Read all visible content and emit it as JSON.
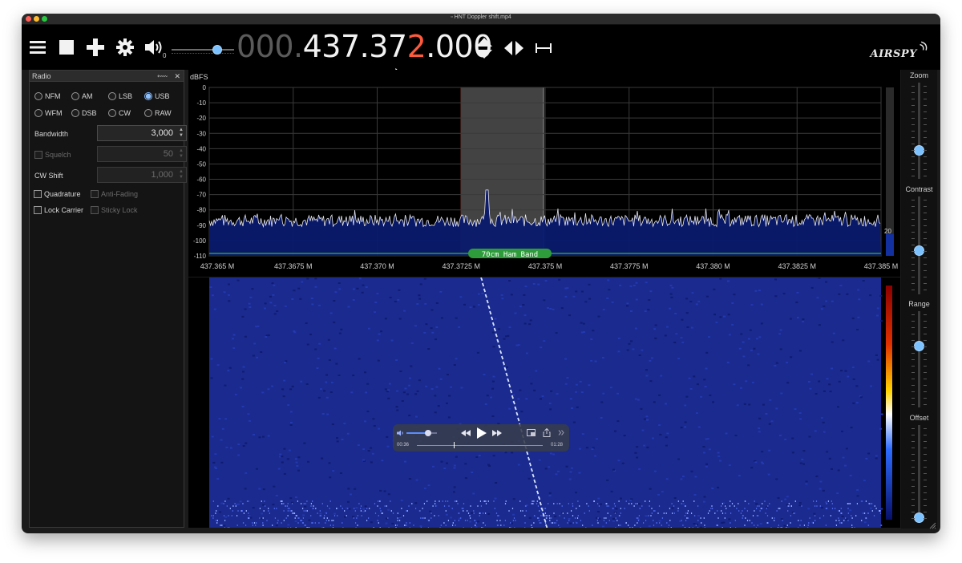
{
  "window": {
    "title": "HNT Doppler shift.mp4"
  },
  "toolbar": {
    "volume_sub": "0",
    "frequency": {
      "dim": "000.",
      "lit1": "437.37",
      "hot": "2",
      "lit2": ".000"
    },
    "brand": "AIRSPY"
  },
  "radio_panel": {
    "title": "Radio",
    "header_pin": "⬳",
    "header_close": "✕",
    "modes_row1": [
      "NFM",
      "AM",
      "LSB",
      "USB"
    ],
    "modes_row2": [
      "WFM",
      "DSB",
      "CW",
      "RAW"
    ],
    "selected_mode": "USB",
    "bandwidth_label": "Bandwidth",
    "bandwidth_value": "3,000",
    "squelch_label": "Squelch",
    "squelch_value": "50",
    "cw_shift_label": "CW Shift",
    "cw_shift_value": "1,000",
    "quadrature_label": "Quadrature",
    "anti_fading_label": "Anti-Fading",
    "lock_carrier_label": "Lock Carrier",
    "sticky_lock_label": "Sticky Lock"
  },
  "spectrum": {
    "unit_label": "dBFS",
    "y_ticks": [
      "0",
      "-10",
      "-20",
      "-30",
      "-40",
      "-50",
      "-60",
      "-70",
      "-80",
      "-90",
      "-100",
      "-110"
    ],
    "x_ticks": [
      "437.365 M",
      "437.3675 M",
      "437.370 M",
      "437.3725 M",
      "437.375 M",
      "437.3775 M",
      "437.380 M",
      "437.3825 M",
      "437.385 M"
    ],
    "band_label": "70cm Ham Band",
    "level_readout": "20",
    "colors": {
      "grid": "#3a3a3a",
      "trace": "#e8e8f0",
      "fill": "#0a1a6e",
      "band": "#2e9c3a",
      "filter": "#5a5a5a",
      "edge": "#c0392b"
    }
  },
  "right_sliders": {
    "zoom": "Zoom",
    "contrast": "Contrast",
    "range": "Range",
    "offset": "Offset"
  },
  "player": {
    "elapsed": "00:36",
    "remaining": "01:28",
    "progress": 0.29,
    "volume_level": 0.72
  }
}
